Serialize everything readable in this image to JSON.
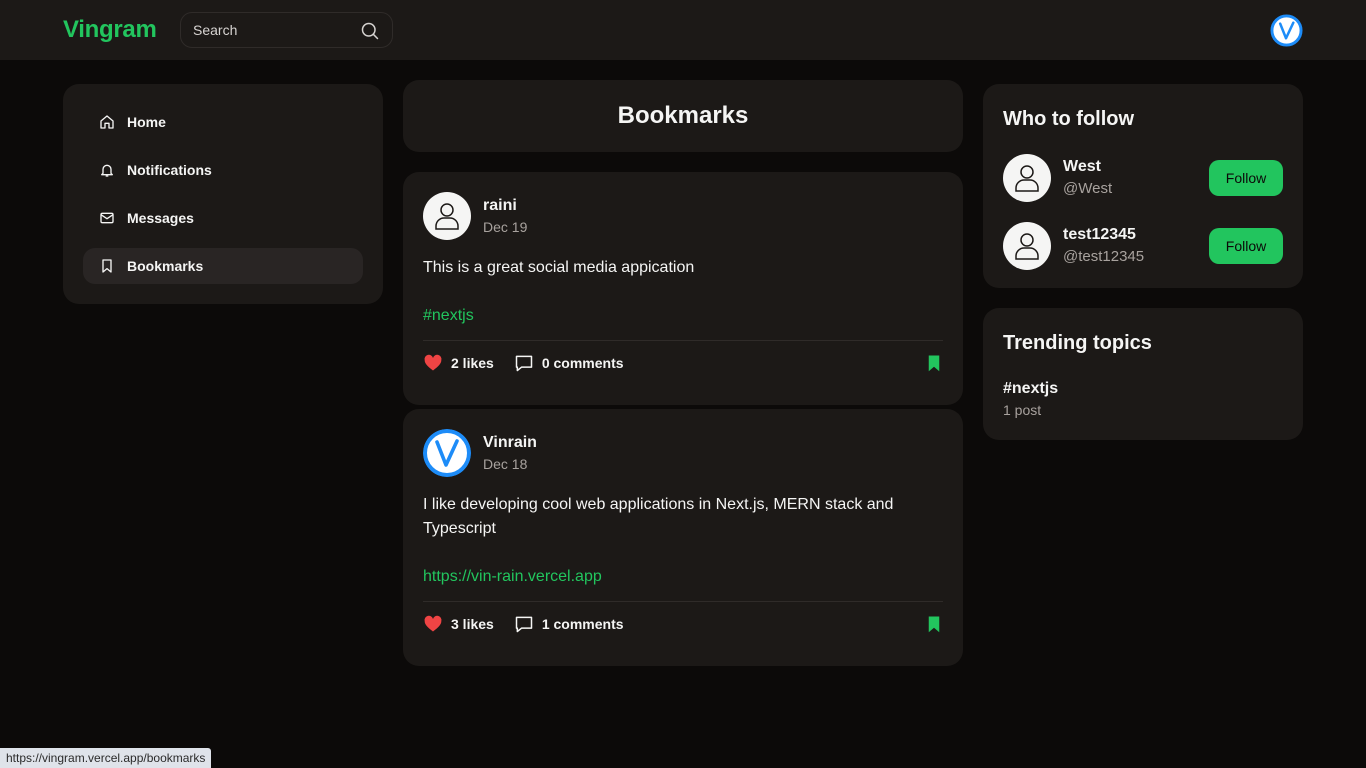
{
  "app": {
    "logo": "Vingram"
  },
  "search": {
    "placeholder": "Search"
  },
  "sidebar": {
    "items": [
      {
        "label": "Home",
        "icon": "home-icon"
      },
      {
        "label": "Notifications",
        "icon": "bell-icon"
      },
      {
        "label": "Messages",
        "icon": "mail-icon"
      },
      {
        "label": "Bookmarks",
        "icon": "bookmark-icon",
        "active": true
      }
    ]
  },
  "main": {
    "title": "Bookmarks",
    "posts": [
      {
        "user": "raini",
        "date": "Dec 19",
        "text": "This is a great social media appication",
        "link": "#nextjs",
        "likes": "2 likes",
        "comments": "0 comments"
      },
      {
        "user": "Vinrain",
        "date": "Dec 18",
        "text": "I like developing cool web applications in Next.js, MERN stack and Typescript",
        "link": "https://vin-rain.vercel.app",
        "likes": "3 likes",
        "comments": "1 comments"
      }
    ]
  },
  "who_to_follow": {
    "title": "Who to follow",
    "users": [
      {
        "name": "West",
        "handle": "@West",
        "button": "Follow"
      },
      {
        "name": "test12345",
        "handle": "@test12345",
        "button": "Follow"
      }
    ]
  },
  "trending": {
    "title": "Trending topics",
    "topics": [
      {
        "tag": "#nextjs",
        "count": "1 post"
      }
    ]
  },
  "status_bar": {
    "url": "https://vingram.vercel.app/bookmarks"
  },
  "colors": {
    "accent": "#22c55e",
    "background": "#0c0a09",
    "card": "#1c1917",
    "like": "#ef4444",
    "avatar_blue": "#1d8cf8"
  }
}
